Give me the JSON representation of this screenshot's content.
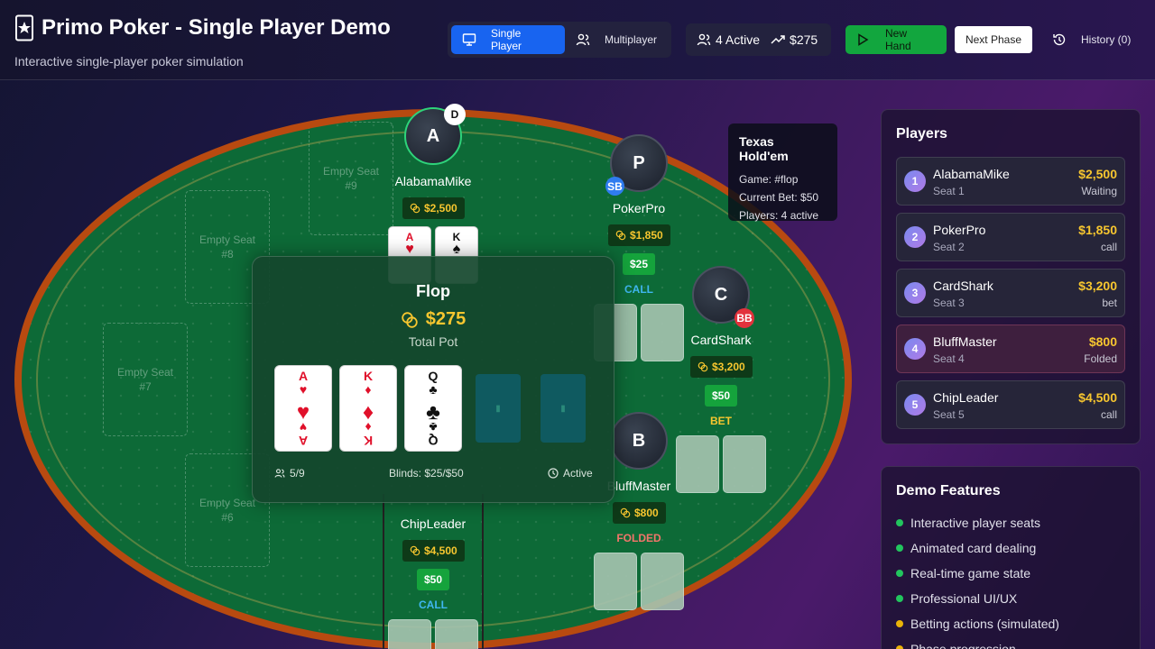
{
  "header": {
    "title": "Primo Poker - Single Player Demo",
    "subtitle": "Interactive single-player poker simulation",
    "modes": [
      {
        "label": "Single Player",
        "active": true,
        "icon": "monitor-icon"
      },
      {
        "label": "Multiplayer",
        "active": false,
        "icon": "users-icon"
      }
    ],
    "stats": {
      "active": "4 Active",
      "pot": "$275"
    },
    "new_hand": "New Hand",
    "next_phase": "Next Phase",
    "history": "History (0)"
  },
  "table": {
    "empty_seats": [
      {
        "label": "Empty Seat",
        "num": "#9"
      },
      {
        "label": "Empty Seat",
        "num": "#8"
      },
      {
        "label": "Empty Seat",
        "num": "#7"
      },
      {
        "label": "Empty Seat",
        "num": "#6"
      }
    ],
    "seats": {
      "alabama": {
        "initial": "A",
        "name": "AlabamaMike",
        "chips": "$2,500",
        "badge": "D",
        "cards": [
          {
            "rank": "A",
            "suit": "♥"
          },
          {
            "rank": "K",
            "suit": "♠"
          }
        ]
      },
      "pokerpro": {
        "initial": "P",
        "name": "PokerPro",
        "chips": "$1,850",
        "badge": "SB",
        "bet": "$25",
        "action": "CALL"
      },
      "cardshark": {
        "initial": "C",
        "name": "CardShark",
        "chips": "$3,200",
        "badge": "BB",
        "bet": "$50",
        "action": "BET"
      },
      "bluffmaster": {
        "initial": "B",
        "name": "BluffMaster",
        "chips": "$800",
        "action": "FOLDED"
      },
      "chipleader": {
        "name": "ChipLeader",
        "chips": "$4,500",
        "bet": "$50",
        "action": "CALL"
      }
    },
    "center": {
      "phase": "Flop",
      "pot": "$275",
      "pot_label": "Total Pot",
      "board": [
        {
          "rank": "A",
          "suit": "♥"
        },
        {
          "rank": "K",
          "suit": "♦"
        },
        {
          "rank": "Q",
          "suit": "♣"
        }
      ],
      "seats": "5/9",
      "blinds": "Blinds: $25/$50",
      "status": "Active"
    },
    "info": {
      "title": "Texas Hold'em",
      "game": "Game: #flop",
      "current_bet": "Current Bet: $50",
      "players": "Players: 4 active"
    }
  },
  "players_panel": {
    "title": "Players",
    "players": [
      {
        "num": "1",
        "name": "AlabamaMike",
        "seat": "Seat 1",
        "chips": "$2,500",
        "status": "Waiting"
      },
      {
        "num": "2",
        "name": "PokerPro",
        "seat": "Seat 2",
        "chips": "$1,850",
        "status": "call"
      },
      {
        "num": "3",
        "name": "CardShark",
        "seat": "Seat 3",
        "chips": "$3,200",
        "status": "bet"
      },
      {
        "num": "4",
        "name": "BluffMaster",
        "seat": "Seat 4",
        "chips": "$800",
        "status": "Folded"
      },
      {
        "num": "5",
        "name": "ChipLeader",
        "seat": "Seat 5",
        "chips": "$4,500",
        "status": "call"
      }
    ]
  },
  "features_panel": {
    "title": "Demo Features",
    "items": [
      {
        "label": "Interactive player seats",
        "color": "#22c55e"
      },
      {
        "label": "Animated card dealing",
        "color": "#22c55e"
      },
      {
        "label": "Real-time game state",
        "color": "#22c55e"
      },
      {
        "label": "Professional UI/UX",
        "color": "#22c55e"
      },
      {
        "label": "Betting actions (simulated)",
        "color": "#eab308"
      },
      {
        "label": "Phase progression",
        "color": "#eab308"
      }
    ]
  },
  "colors": {
    "accent": "#1864f0",
    "chips": "#f7c62f",
    "green": "#15a33c",
    "felt": "#0d6a37",
    "rail": "#b84a10"
  }
}
